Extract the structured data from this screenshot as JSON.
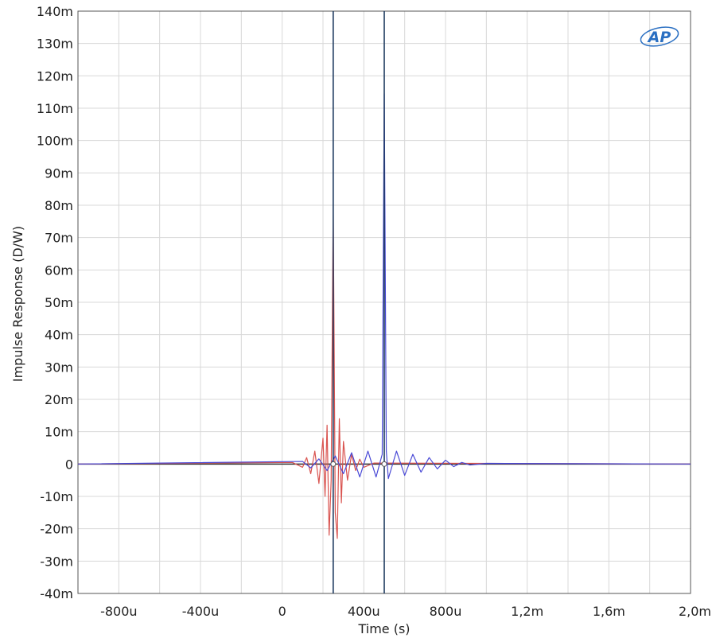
{
  "chart_data": {
    "type": "line",
    "title": "",
    "xlabel": "Time (s)",
    "ylabel": "Impulse Response (D/W)",
    "xlim": [
      -0.001,
      0.002
    ],
    "ylim": [
      -0.04,
      0.14
    ],
    "grid": true,
    "x_ticks": [
      {
        "value": -0.0008,
        "label": "-800u"
      },
      {
        "value": -0.0004,
        "label": "-400u"
      },
      {
        "value": 0,
        "label": "0"
      },
      {
        "value": 0.0004,
        "label": "400u"
      },
      {
        "value": 0.0008,
        "label": "800u"
      },
      {
        "value": 0.0012,
        "label": "1,2m"
      },
      {
        "value": 0.0016,
        "label": "1,6m"
      },
      {
        "value": 0.002,
        "label": "2,0m"
      }
    ],
    "y_ticks": [
      {
        "value": 0.14,
        "label": "140m"
      },
      {
        "value": 0.13,
        "label": "130m"
      },
      {
        "value": 0.12,
        "label": "120m"
      },
      {
        "value": 0.11,
        "label": "110m"
      },
      {
        "value": 0.1,
        "label": "100m"
      },
      {
        "value": 0.09,
        "label": "90m"
      },
      {
        "value": 0.08,
        "label": "80m"
      },
      {
        "value": 0.07,
        "label": "70m"
      },
      {
        "value": 0.06,
        "label": "60m"
      },
      {
        "value": 0.05,
        "label": "50m"
      },
      {
        "value": 0.04,
        "label": "40m"
      },
      {
        "value": 0.03,
        "label": "30m"
      },
      {
        "value": 0.02,
        "label": "20m"
      },
      {
        "value": 0.01,
        "label": "10m"
      },
      {
        "value": 0,
        "label": "0"
      },
      {
        "value": -0.01,
        "label": "-10m"
      },
      {
        "value": -0.02,
        "label": "-20m"
      },
      {
        "value": -0.03,
        "label": "-30m"
      },
      {
        "value": -0.04,
        "label": "-40m"
      }
    ],
    "cursors": [
      0.00025,
      0.0005
    ],
    "series": [
      {
        "color": "#d9534f",
        "x": [
          -0.001,
          5e-05,
          0.0001,
          0.00012,
          0.00014,
          0.00016,
          0.00018,
          0.0002,
          0.00021,
          0.00022,
          0.00023,
          0.00024,
          0.00025,
          0.00026,
          0.00027,
          0.00028,
          0.00029,
          0.0003,
          0.00032,
          0.00034,
          0.00036,
          0.00038,
          0.0004,
          0.00045,
          0.002
        ],
        "y": [
          0,
          0.0005,
          -0.001,
          0.002,
          -0.003,
          0.004,
          -0.006,
          0.008,
          -0.01,
          0.012,
          -0.022,
          -0.005,
          0.08,
          -0.015,
          -0.023,
          0.014,
          -0.012,
          0.007,
          -0.005,
          0.003,
          -0.002,
          0.0015,
          -0.001,
          0.0003,
          0
        ]
      },
      {
        "color": "#4a4ad6",
        "x": [
          -0.001,
          0.0001,
          0.00014,
          0.00018,
          0.00022,
          0.00026,
          0.0003,
          0.00034,
          0.00038,
          0.00042,
          0.00046,
          0.00049,
          0.0005,
          0.00051,
          0.00052,
          0.00056,
          0.0006,
          0.00064,
          0.00068,
          0.00072,
          0.00076,
          0.0008,
          0.00084,
          0.00088,
          0.00092,
          0.001,
          0.002
        ],
        "y": [
          0,
          0.0008,
          -0.0012,
          0.0016,
          -0.002,
          0.0025,
          -0.003,
          0.0035,
          -0.004,
          0.004,
          -0.004,
          0.003,
          0.1145,
          0.004,
          -0.0045,
          0.004,
          -0.0035,
          0.003,
          -0.0025,
          0.002,
          -0.0015,
          0.0012,
          -0.0008,
          0.0005,
          -0.0003,
          0.0002,
          0
        ]
      }
    ]
  },
  "logo": {
    "text": "AP"
  }
}
